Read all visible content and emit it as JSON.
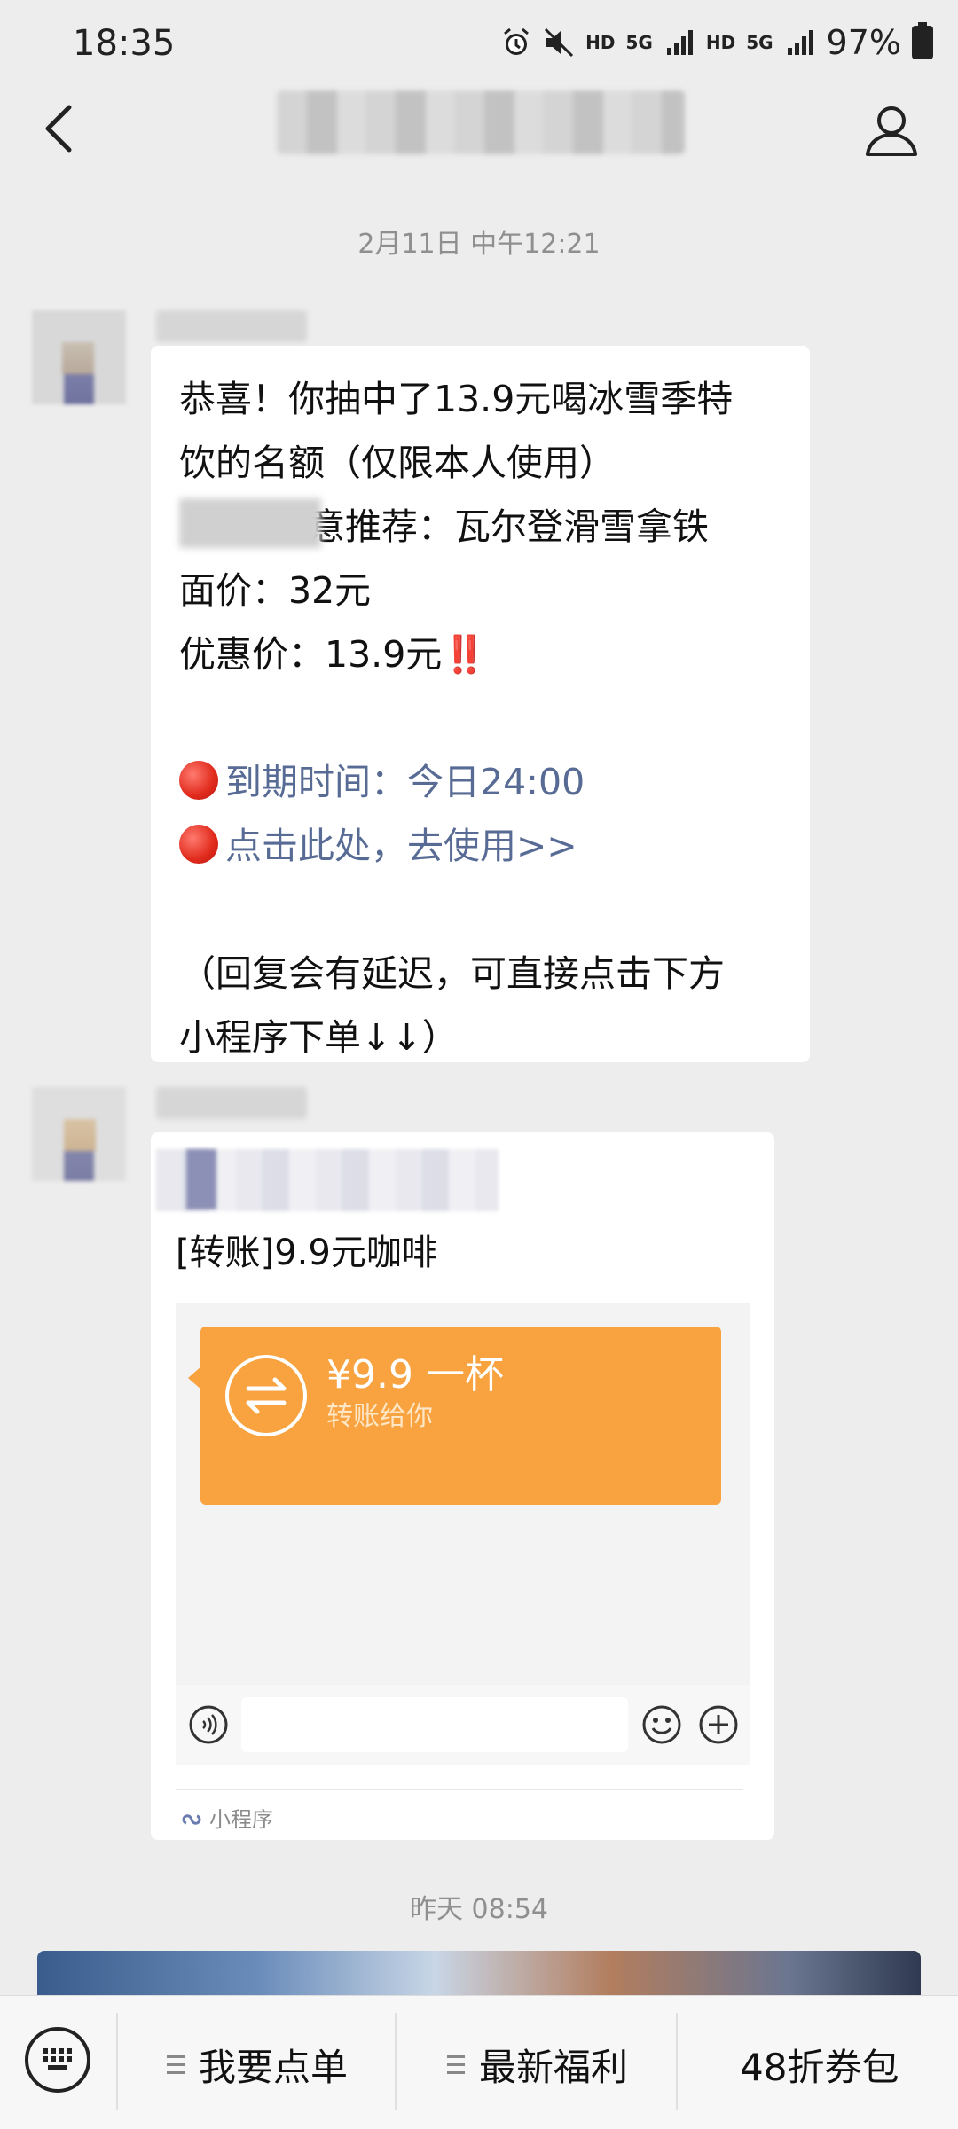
{
  "status_bar": {
    "time": "18:35",
    "network_1": "HD",
    "signal_1": "5G",
    "network_2": "HD",
    "signal_2": "5G",
    "battery": "97%",
    "icons": [
      "alarm-icon",
      "mute-icon",
      "signal-icon",
      "battery-icon"
    ]
  },
  "header": {
    "back_icon": "chevron-left-icon",
    "profile_icon": "person-icon"
  },
  "chat": {
    "timestamp_1": "2月11日 中午12:21",
    "message_1": {
      "lines": [
        "恭喜！你抽中了13.9元喝冰雪季特",
        "饮的名额（仅限本人使用）",
        "意推荐：瓦尔登滑雪拿铁",
        "面价：32元",
        "优惠价：13.9元",
        "",
        "到期时间：今日24:00",
        "点击此处，去使用>>",
        "",
        "（回复会有延迟，可直接点击下方",
        "小程序下单↓↓）"
      ],
      "alert_mark": "‼️"
    },
    "message_2": {
      "title": "[转账]9.9元咖啡",
      "transfer_amount": "¥9.9 一杯",
      "transfer_sub": "转账给你",
      "source_label": "小程序"
    },
    "timestamp_2": "昨天 08:54"
  },
  "bottom_menu": {
    "keyboard_icon": "keyboard-icon",
    "items": [
      "我要点单",
      "最新福利",
      "48折券包"
    ]
  },
  "colors": {
    "background": "#ededed",
    "bubble": "#ffffff",
    "link": "#576b95",
    "transfer_orange": "#f8a240"
  }
}
